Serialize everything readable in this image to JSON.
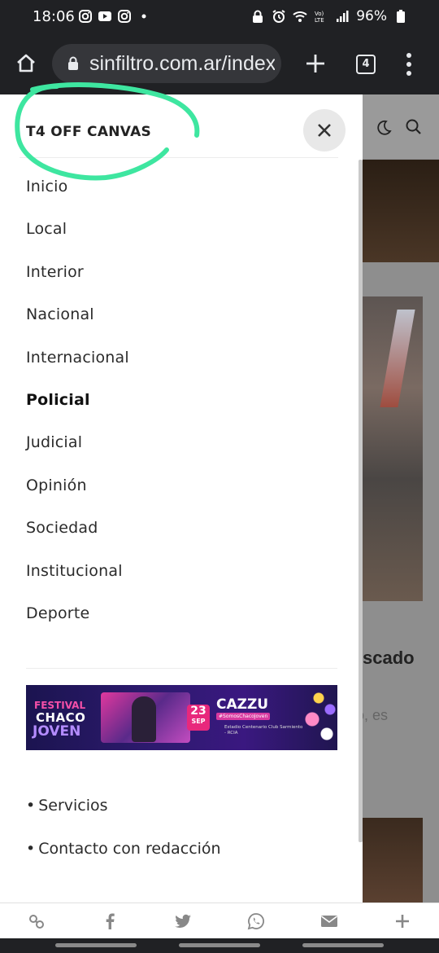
{
  "status_bar": {
    "time": "18:06",
    "battery": "96%",
    "left_icons": [
      "instagram-icon",
      "youtube-icon",
      "instagram-icon",
      "dot-icon"
    ],
    "right_icons": [
      "lock-icon",
      "alarm-icon",
      "wifi-icon",
      "volte-icon",
      "signal-icon",
      "battery-icon"
    ]
  },
  "browser": {
    "url": "sinfiltro.com.ar/index",
    "tab_count": "4"
  },
  "offcanvas": {
    "title": "T4 OFF CANVAS",
    "menu": [
      {
        "label": "Inicio",
        "active": false
      },
      {
        "label": "Local",
        "active": false
      },
      {
        "label": "Interior",
        "active": false
      },
      {
        "label": "Nacional",
        "active": false
      },
      {
        "label": "Internacional",
        "active": false
      },
      {
        "label": "Policial",
        "active": true
      },
      {
        "label": "Judicial",
        "active": false
      },
      {
        "label": "Opinión",
        "active": false
      },
      {
        "label": "Sociedad",
        "active": false
      },
      {
        "label": "Institucional",
        "active": false
      },
      {
        "label": "Deporte",
        "active": false
      }
    ],
    "banner": {
      "festival": "FESTIVAL",
      "chaco": "CHACO",
      "joven": "JOVEN",
      "day": "23",
      "month": "SEP",
      "artist": "CAZZU",
      "hashtag": "#SomosChacoJoven",
      "venue": "Estadio Centenario Club Sarmiento - RCIA"
    },
    "links": [
      "Servicios",
      "Contacto con redacción"
    ]
  },
  "background_page": {
    "headline_fragment": "scado",
    "snippet_fragment": "o, es"
  },
  "share_bar": {
    "icons": [
      "link-icon",
      "facebook-icon",
      "twitter-icon",
      "whatsapp-icon",
      "email-icon",
      "plus-icon"
    ]
  },
  "colors": {
    "scribble": "#3ee6a0",
    "chrome_bg": "#202124",
    "url_pill": "#35363a"
  }
}
